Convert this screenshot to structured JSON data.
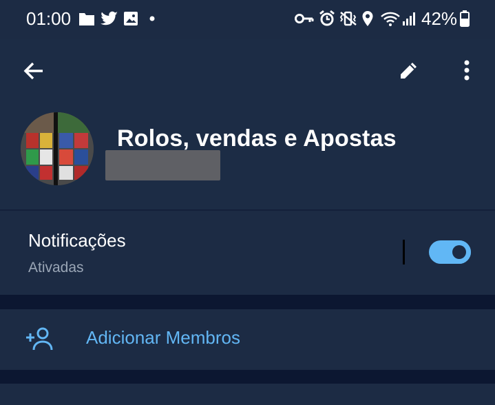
{
  "status_bar": {
    "time": "01:00",
    "battery": "42%",
    "left_icons": [
      "folder-icon",
      "twitter-icon",
      "image-icon",
      "dot-icon"
    ],
    "right_icons": [
      "key-icon",
      "alarm-icon",
      "vibrate-icon",
      "location-icon",
      "wifi-icon",
      "signal-icon",
      "battery-icon"
    ]
  },
  "toolbar": {
    "back_icon": "back-arrow-icon",
    "edit_icon": "pencil-icon",
    "more_icon": "more-vertical-icon"
  },
  "group": {
    "name": "Rolos, vendas e Apostas"
  },
  "notifications": {
    "title": "Notificações",
    "status": "Ativadas",
    "enabled": true
  },
  "add_members": {
    "label": "Adicionar Membros"
  },
  "colors": {
    "background": "#1c2b44",
    "separator": "#0c1731",
    "accent": "#62b6f4",
    "secondary_text": "#9aa6b6"
  }
}
